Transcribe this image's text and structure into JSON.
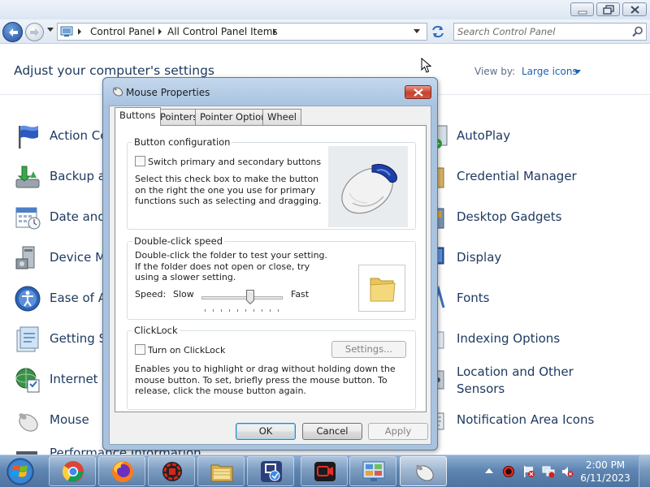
{
  "explorer": {
    "breadcrumb": [
      "Control Panel",
      "All Control Panel Items"
    ],
    "search_placeholder": "Search Control Panel",
    "page_title": "Adjust your computer's settings",
    "view_by_label": "View by:",
    "view_by_value": "Large icons",
    "left_items": [
      {
        "label": "Action Ce",
        "icon": "flag-icon"
      },
      {
        "label": "Backup a",
        "icon": "backup-icon"
      },
      {
        "label": "Date and",
        "icon": "calendar-clock-icon"
      },
      {
        "label": "Device M",
        "icon": "device-manager-icon"
      },
      {
        "label": "Ease of A",
        "icon": "ease-of-access-icon"
      },
      {
        "label": "Getting S",
        "icon": "getting-started-icon"
      },
      {
        "label": "Internet C",
        "icon": "internet-options-icon"
      },
      {
        "label": "Mouse",
        "icon": "mouse-icon"
      },
      {
        "label": "Performance Information",
        "icon": "performance-icon"
      }
    ],
    "right_items": [
      {
        "label": "AutoPlay",
        "icon": "autoplay-icon"
      },
      {
        "label": "Credential Manager",
        "icon": "credential-manager-icon"
      },
      {
        "label": "Desktop Gadgets",
        "icon": "gadgets-icon"
      },
      {
        "label": "Display",
        "icon": "display-icon"
      },
      {
        "label": "Fonts",
        "icon": "fonts-icon"
      },
      {
        "label": "Indexing Options",
        "icon": "indexing-icon"
      },
      {
        "label": "Location and Other Sensors",
        "icon": "location-sensor-icon"
      },
      {
        "label": "Notification Area Icons",
        "icon": "notification-area-icon"
      }
    ]
  },
  "dialog": {
    "title": "Mouse Properties",
    "tabs": [
      "Buttons",
      "Pointers",
      "Pointer Options",
      "Wheel"
    ],
    "active_tab": "Buttons",
    "button_configuration": {
      "title": "Button configuration",
      "checkbox_label": "Switch primary and secondary buttons",
      "checked": false,
      "description": "Select this check box to make the button on the right the one you use for primary functions such as selecting and dragging."
    },
    "double_click": {
      "title": "Double-click speed",
      "description": "Double-click the folder to test your setting. If the folder does not open or close, try using a slower setting.",
      "speed_label": "Speed:",
      "slow_label": "Slow",
      "fast_label": "Fast",
      "speed_level": 0.6
    },
    "clicklock": {
      "title": "ClickLock",
      "checkbox_label": "Turn on ClickLock",
      "checked": false,
      "settings_button": "Settings...",
      "description": "Enables you to highlight or drag without holding down the mouse button. To set, briefly press the mouse button. To release, click the mouse button again."
    },
    "buttons": {
      "ok": "OK",
      "cancel": "Cancel",
      "apply": "Apply"
    }
  },
  "taskbar": {
    "apps": [
      "chrome-icon",
      "firefox-icon",
      "red-app-icon",
      "file-explorer-icon",
      "screen-tool-icon",
      "recorder-icon",
      "control-panel-icon",
      "mouse-icon"
    ],
    "tray": [
      "red-circle-icon",
      "flag-icon",
      "network-icon",
      "volume-muted-icon"
    ],
    "time": "2:00 PM",
    "date": "6/11/2023"
  },
  "colors": {
    "link_text": "#1e3a60",
    "taskbar": "#5f86b2",
    "dialog_frame": "#a9c3df",
    "close_button": "#c6412c"
  }
}
